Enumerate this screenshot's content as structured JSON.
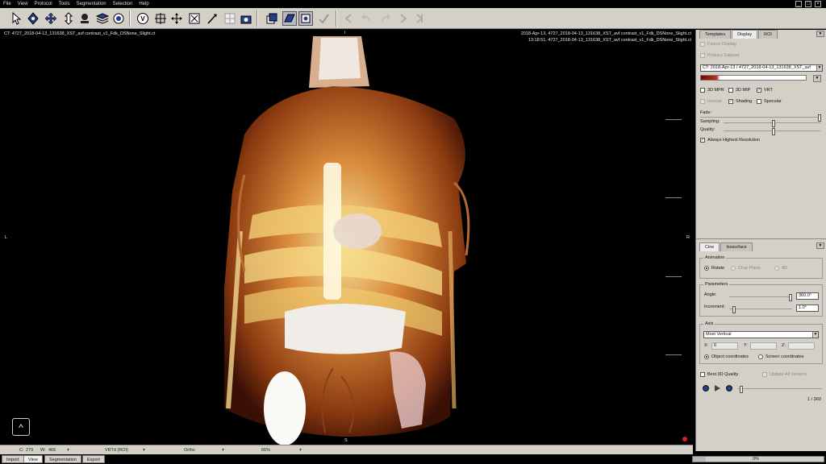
{
  "menu": [
    "File",
    "View",
    "Protocol",
    "Tools",
    "Segmentation",
    "Selection",
    "Help"
  ],
  "viewer": {
    "top_left": "CT: 4727_2018-04-13_131638_XST_avf contrast_v1_Fdk_DSNone_Slight.ct",
    "top_right_1": "2018-Apr-13, 4727_2018-04-13_131638_XST_avf contrast_v1_Fdk_DSNone_Slight.ct",
    "top_right_2": "13:18:51, 4727_2018-04-13_131638_XST_avf contrast_v1_Fdk_DSNone_Slight.ct",
    "orient_top": "I",
    "orient_left": "L",
    "orient_right": "R",
    "orient_bottom": "S",
    "logo_glyph": "^"
  },
  "panel": {
    "tabs": [
      "Templates",
      "Display",
      "ROI"
    ],
    "active_tab": "Display",
    "fusion_display": "Fusion Display",
    "primary_dataset": "Primary Dataset",
    "dataset_select": "CT: 2018-Apr-13 / 4727_2018-04-13_131638_XST_avf",
    "mode_3d_mpr": "3D MPR",
    "mode_3d_mip": "3D MIP",
    "mode_vrt": "VRT",
    "inverse": "Inverse",
    "shading": "Shading",
    "specular": "Specular",
    "fade": "Fade:",
    "sampling": "Sampling:",
    "quality": "Quality:",
    "always_highest": "Always Highest Resolution",
    "lower_tabs": [
      "Cine",
      "Isosurface"
    ],
    "animation_title": "Animation",
    "rotate": "Rotate",
    "crop_plane": "Crop Plane",
    "four_d": "4D",
    "parameters_title": "Parameters",
    "angle_label": "Angle:",
    "angle_value": "360.0°",
    "increment_label": "Increment:",
    "increment_value": "1.0°",
    "axis_title": "Axis",
    "axis_select": "Most Vertical",
    "x_label": "X:",
    "x_value": "0",
    "y_label": "Y:",
    "z_label": "Z:",
    "object_coords": "Object coordinates",
    "screen_coords": "Screen coordinates",
    "best_3d": "Best 3D Quality",
    "update_all": "Update All Viewers",
    "frame_counter": "1 / 360"
  },
  "status": {
    "c_label": "C:",
    "c_value": "279",
    "w_label": "W:",
    "w_value": "466",
    "render_mode": "VRTd (ROI)",
    "projection": "Ortho",
    "zoom": "66%",
    "progress_text": "0%"
  },
  "bottom_tabs": [
    "Import",
    "View",
    "Segmentation",
    "Export"
  ],
  "active_bottom_tab": "View",
  "colors": {
    "accent": "#3355aa",
    "panel_bg": "#d4d0c8"
  }
}
